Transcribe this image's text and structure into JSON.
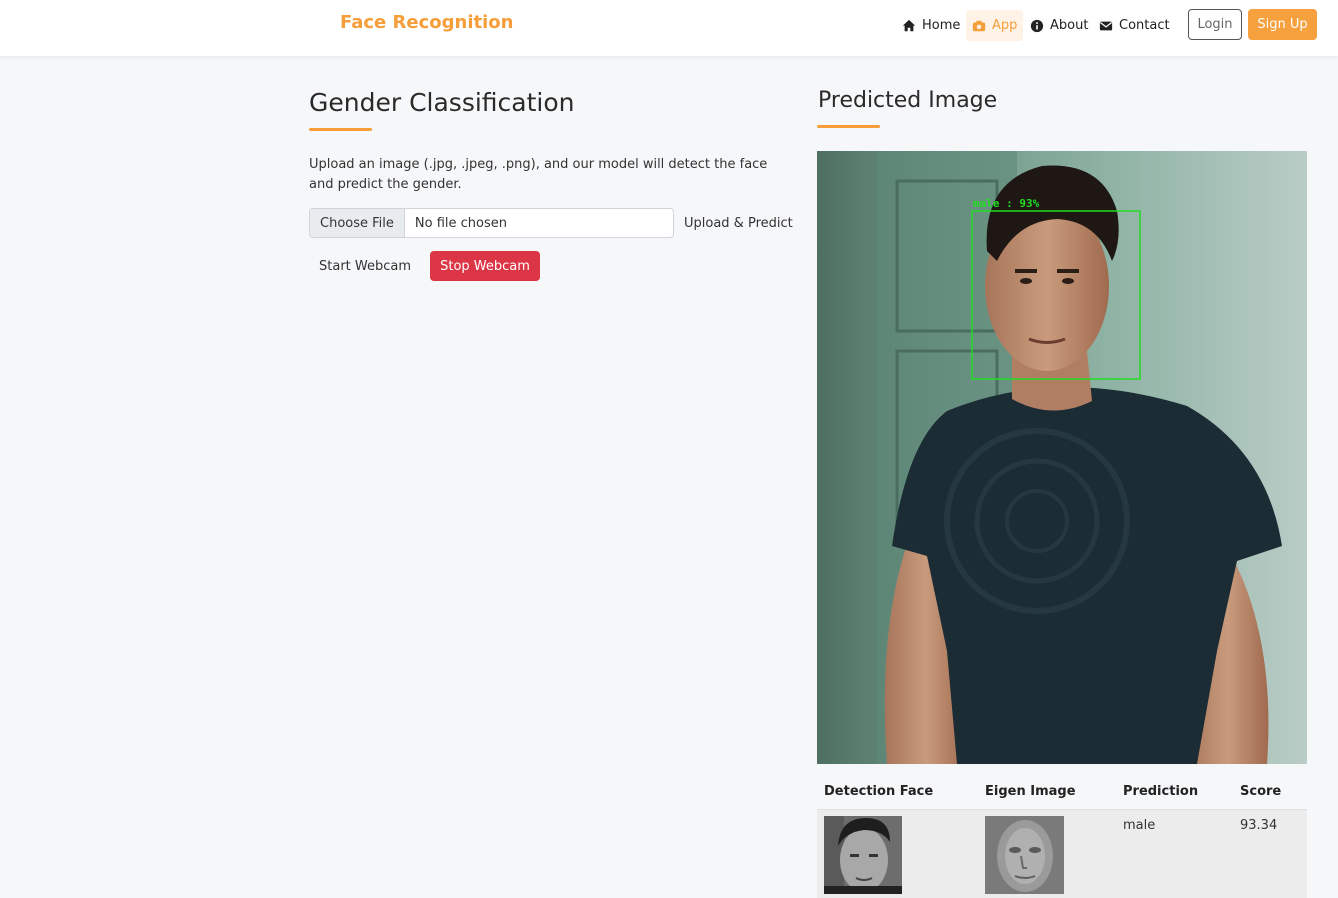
{
  "nav": {
    "brand": "Face Recognition",
    "links": [
      {
        "label": "Home",
        "icon": "home-icon"
      },
      {
        "label": "App",
        "icon": "camera-icon",
        "active": true
      },
      {
        "label": "About",
        "icon": "info-icon"
      },
      {
        "label": "Contact",
        "icon": "envelope-icon"
      }
    ],
    "login": "Login",
    "signup": "Sign Up"
  },
  "left": {
    "title": "Gender Classification",
    "description": "Upload an image (.jpg, .jpeg, .png), and our model will detect the face and predict the gender.",
    "file_button": "Choose File",
    "file_status": "No file chosen",
    "upload_button": "Upload & Predict",
    "start_webcam": "Start Webcam",
    "stop_webcam": "Stop Webcam"
  },
  "right": {
    "title": "Predicted Image",
    "detection_label": "male : 93%"
  },
  "table": {
    "headers": [
      "Detection Face",
      "Eigen Image",
      "Prediction",
      "Score"
    ],
    "rows": [
      {
        "prediction": "male",
        "score": "93.34"
      }
    ]
  },
  "colors": {
    "accent": "#f59e3a",
    "danger": "#dc3545",
    "detection_box": "#22dd22"
  }
}
